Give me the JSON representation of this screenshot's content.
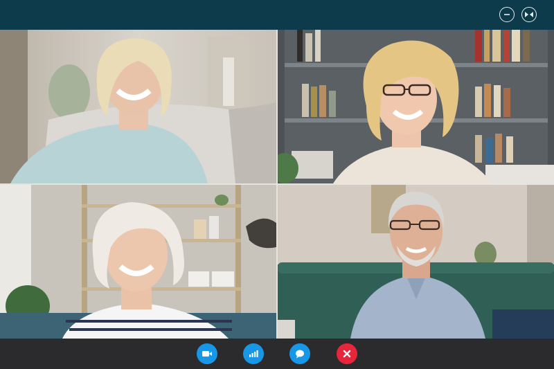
{
  "window": {
    "buttons": [
      {
        "icon": "minimize-icon"
      },
      {
        "icon": "fullscreen-icon"
      }
    ]
  },
  "participants": [
    {
      "position": "top-left",
      "description_icon": "video-feed"
    },
    {
      "position": "top-right",
      "description_icon": "video-feed"
    },
    {
      "position": "bottom-left",
      "description_icon": "video-feed"
    },
    {
      "position": "bottom-right",
      "description_icon": "video-feed"
    }
  ],
  "controls": [
    {
      "icon": "camera-icon",
      "color": "#1797e6"
    },
    {
      "icon": "signal-bars-icon",
      "color": "#1797e6"
    },
    {
      "icon": "chat-bubble-icon",
      "color": "#1797e6"
    },
    {
      "icon": "end-call-icon",
      "color": "#e6263a"
    }
  ],
  "colors": {
    "titlebar": "#0e3b4b",
    "toolbar": "#2b2b2d",
    "accent": "#1797e6",
    "danger": "#e6263a"
  }
}
